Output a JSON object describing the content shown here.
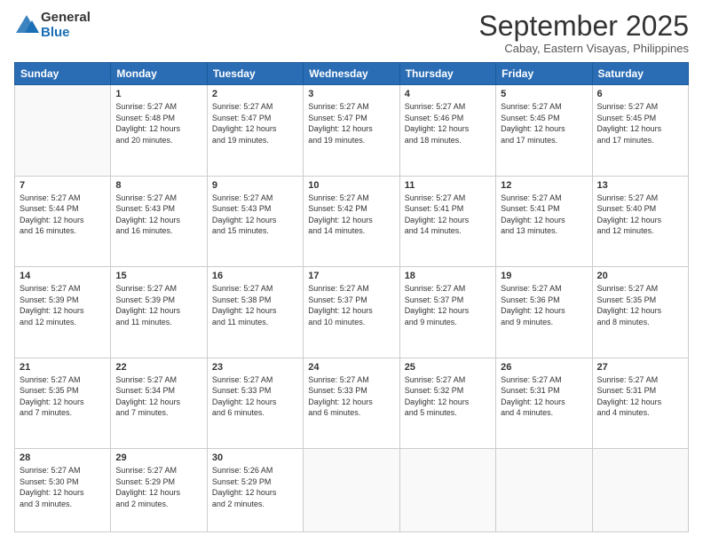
{
  "logo": {
    "general": "General",
    "blue": "Blue"
  },
  "header": {
    "month": "September 2025",
    "location": "Cabay, Eastern Visayas, Philippines"
  },
  "weekdays": [
    "Sunday",
    "Monday",
    "Tuesday",
    "Wednesday",
    "Thursday",
    "Friday",
    "Saturday"
  ],
  "weeks": [
    [
      {
        "day": "",
        "info": ""
      },
      {
        "day": "1",
        "info": "Sunrise: 5:27 AM\nSunset: 5:48 PM\nDaylight: 12 hours\nand 20 minutes."
      },
      {
        "day": "2",
        "info": "Sunrise: 5:27 AM\nSunset: 5:47 PM\nDaylight: 12 hours\nand 19 minutes."
      },
      {
        "day": "3",
        "info": "Sunrise: 5:27 AM\nSunset: 5:47 PM\nDaylight: 12 hours\nand 19 minutes."
      },
      {
        "day": "4",
        "info": "Sunrise: 5:27 AM\nSunset: 5:46 PM\nDaylight: 12 hours\nand 18 minutes."
      },
      {
        "day": "5",
        "info": "Sunrise: 5:27 AM\nSunset: 5:45 PM\nDaylight: 12 hours\nand 17 minutes."
      },
      {
        "day": "6",
        "info": "Sunrise: 5:27 AM\nSunset: 5:45 PM\nDaylight: 12 hours\nand 17 minutes."
      }
    ],
    [
      {
        "day": "7",
        "info": "Sunrise: 5:27 AM\nSunset: 5:44 PM\nDaylight: 12 hours\nand 16 minutes."
      },
      {
        "day": "8",
        "info": "Sunrise: 5:27 AM\nSunset: 5:43 PM\nDaylight: 12 hours\nand 16 minutes."
      },
      {
        "day": "9",
        "info": "Sunrise: 5:27 AM\nSunset: 5:43 PM\nDaylight: 12 hours\nand 15 minutes."
      },
      {
        "day": "10",
        "info": "Sunrise: 5:27 AM\nSunset: 5:42 PM\nDaylight: 12 hours\nand 14 minutes."
      },
      {
        "day": "11",
        "info": "Sunrise: 5:27 AM\nSunset: 5:41 PM\nDaylight: 12 hours\nand 14 minutes."
      },
      {
        "day": "12",
        "info": "Sunrise: 5:27 AM\nSunset: 5:41 PM\nDaylight: 12 hours\nand 13 minutes."
      },
      {
        "day": "13",
        "info": "Sunrise: 5:27 AM\nSunset: 5:40 PM\nDaylight: 12 hours\nand 12 minutes."
      }
    ],
    [
      {
        "day": "14",
        "info": "Sunrise: 5:27 AM\nSunset: 5:39 PM\nDaylight: 12 hours\nand 12 minutes."
      },
      {
        "day": "15",
        "info": "Sunrise: 5:27 AM\nSunset: 5:39 PM\nDaylight: 12 hours\nand 11 minutes."
      },
      {
        "day": "16",
        "info": "Sunrise: 5:27 AM\nSunset: 5:38 PM\nDaylight: 12 hours\nand 11 minutes."
      },
      {
        "day": "17",
        "info": "Sunrise: 5:27 AM\nSunset: 5:37 PM\nDaylight: 12 hours\nand 10 minutes."
      },
      {
        "day": "18",
        "info": "Sunrise: 5:27 AM\nSunset: 5:37 PM\nDaylight: 12 hours\nand 9 minutes."
      },
      {
        "day": "19",
        "info": "Sunrise: 5:27 AM\nSunset: 5:36 PM\nDaylight: 12 hours\nand 9 minutes."
      },
      {
        "day": "20",
        "info": "Sunrise: 5:27 AM\nSunset: 5:35 PM\nDaylight: 12 hours\nand 8 minutes."
      }
    ],
    [
      {
        "day": "21",
        "info": "Sunrise: 5:27 AM\nSunset: 5:35 PM\nDaylight: 12 hours\nand 7 minutes."
      },
      {
        "day": "22",
        "info": "Sunrise: 5:27 AM\nSunset: 5:34 PM\nDaylight: 12 hours\nand 7 minutes."
      },
      {
        "day": "23",
        "info": "Sunrise: 5:27 AM\nSunset: 5:33 PM\nDaylight: 12 hours\nand 6 minutes."
      },
      {
        "day": "24",
        "info": "Sunrise: 5:27 AM\nSunset: 5:33 PM\nDaylight: 12 hours\nand 6 minutes."
      },
      {
        "day": "25",
        "info": "Sunrise: 5:27 AM\nSunset: 5:32 PM\nDaylight: 12 hours\nand 5 minutes."
      },
      {
        "day": "26",
        "info": "Sunrise: 5:27 AM\nSunset: 5:31 PM\nDaylight: 12 hours\nand 4 minutes."
      },
      {
        "day": "27",
        "info": "Sunrise: 5:27 AM\nSunset: 5:31 PM\nDaylight: 12 hours\nand 4 minutes."
      }
    ],
    [
      {
        "day": "28",
        "info": "Sunrise: 5:27 AM\nSunset: 5:30 PM\nDaylight: 12 hours\nand 3 minutes."
      },
      {
        "day": "29",
        "info": "Sunrise: 5:27 AM\nSunset: 5:29 PM\nDaylight: 12 hours\nand 2 minutes."
      },
      {
        "day": "30",
        "info": "Sunrise: 5:26 AM\nSunset: 5:29 PM\nDaylight: 12 hours\nand 2 minutes."
      },
      {
        "day": "",
        "info": ""
      },
      {
        "day": "",
        "info": ""
      },
      {
        "day": "",
        "info": ""
      },
      {
        "day": "",
        "info": ""
      }
    ]
  ]
}
